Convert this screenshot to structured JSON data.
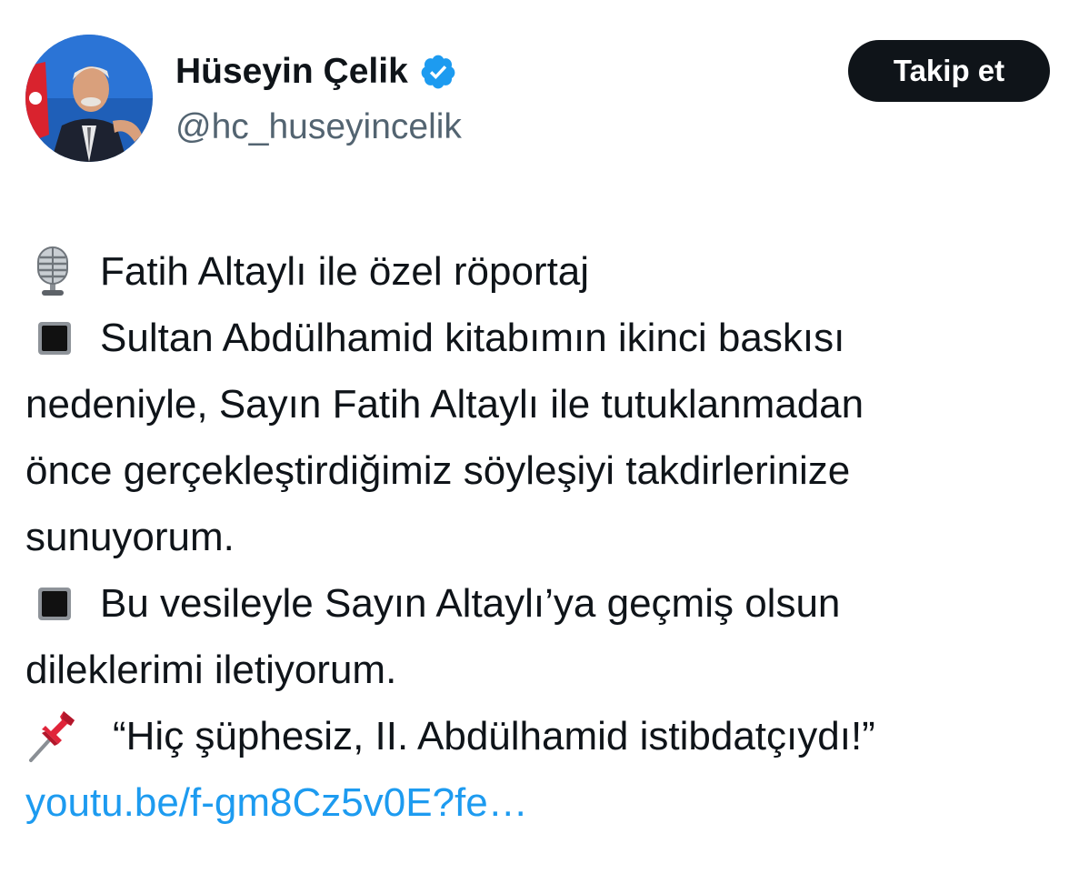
{
  "author": {
    "display_name": "Hüseyin Çelik",
    "handle": "@hc_huseyincelik",
    "verified": true,
    "verified_badge_color": "#1d9bf0"
  },
  "follow_button": {
    "label": "Takip et"
  },
  "tweet": {
    "lines": [
      {
        "icon": "microphone-icon",
        "text": "Fatih Altaylı ile özel röportaj"
      },
      {
        "icon": "black-square-icon",
        "text": "Sultan Abdülhamid kitabımın ikinci baskısı"
      },
      {
        "icon": null,
        "text": "nedeniyle, Sayın Fatih Altaylı ile tutuklanmadan"
      },
      {
        "icon": null,
        "text": "önce gerçekleştirdiğimiz söyleşiyi takdirlerinize"
      },
      {
        "icon": null,
        "text": "sunuyorum."
      },
      {
        "icon": "black-square-icon",
        "text": "Bu vesileyle Sayın Altaylı’ya geçmiş olsun"
      },
      {
        "icon": null,
        "text": "dileklerimi iletiyorum."
      },
      {
        "icon": "pushpin-icon",
        "text": "“Hiç şüphesiz, II. Abdülhamid istibdatçıydı!”"
      }
    ],
    "link_text": "youtu.be/f-gm8Cz5v0E?fe…",
    "link_color": "#1d9bf0"
  }
}
